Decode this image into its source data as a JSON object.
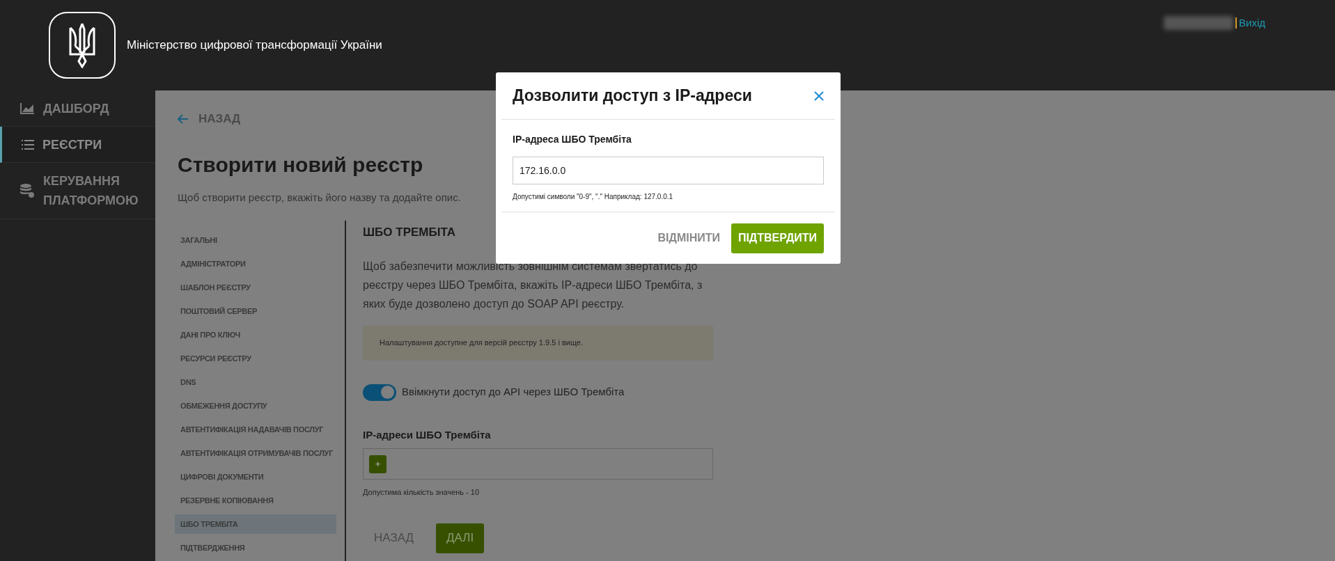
{
  "header": {
    "title": "Міністерство цифрової трансформації України",
    "exit_link": "Вихід"
  },
  "sidebar": {
    "items": [
      {
        "label": "ДАШБОРД",
        "selected": false
      },
      {
        "label": "РЕЄСТРИ",
        "selected": true
      },
      {
        "label": "КЕРУВАННЯ ПЛАТФОРМОЮ",
        "selected": false
      }
    ]
  },
  "page": {
    "back_link": "НАЗАД",
    "title": "Створити новий реєстр",
    "subtitle": "Щоб створити реєстр, вкажіть його назву та додайте опис.",
    "steps": [
      {
        "label": "ЗАГАЛЬНІ",
        "selected": false
      },
      {
        "label": "АДМІНІСТРАТОРИ",
        "selected": false
      },
      {
        "label": "ШАБЛОН РЕЄСТРУ",
        "selected": false
      },
      {
        "label": "ПОШТОВИЙ СЕРВЕР",
        "selected": false
      },
      {
        "label": "ДАНІ ПРО КЛЮЧ",
        "selected": false
      },
      {
        "label": "РЕСУРСИ РЕЄСТРУ",
        "selected": false
      },
      {
        "label": "DNS",
        "selected": false
      },
      {
        "label": "ОБМЕЖЕННЯ ДОСТУПУ",
        "selected": false
      },
      {
        "label": "АВТЕНТИФІКАЦІЯ НАДАВАЧІВ ПОСЛУГ",
        "selected": false
      },
      {
        "label": "АВТЕНТИФІКАЦІЯ ОТРИМУВАЧІВ ПОСЛУГ",
        "selected": false
      },
      {
        "label": "ЦИФРОВІ ДОКУМЕНТИ",
        "selected": false
      },
      {
        "label": "РЕЗЕРВНЕ КОПІЮВАННЯ",
        "selected": false
      },
      {
        "label": "ШБО ТРЕМБІТА",
        "selected": true
      },
      {
        "label": "ПІДТВЕРДЖЕННЯ",
        "selected": false
      }
    ],
    "section": {
      "title": "ШБО ТРЕМБІТА",
      "description": "Щоб забезпечити можливість зовнішнім системам звертатись до реєстру через ШБО Трембіта, вкажіть IP-адреси ШБО Трембіта, з яких буде дозволено доступ до SOAP API реєстру.",
      "notice": "Налаштування доступне для версій реєстру 1.9.5 і вище.",
      "toggle": {
        "label": "Ввімкнути доступ до API через ШБО Трембіта",
        "on": true
      },
      "ip_list": {
        "label": "IP-адреси ШБО Трембіта",
        "add_button": "+",
        "hint": "Допустима кількість значень - 10"
      },
      "back_button": "НАЗАД",
      "next_button": "ДАЛІ"
    }
  },
  "modal": {
    "title": "Дозволити доступ з IP-адреси",
    "field_label": "IP-адреса ШБО Трембіта",
    "value": "172.16.0.0",
    "hint": "Допустимі символи \"0-9\", \".\" Наприклад: 127.0.0.1",
    "cancel_button": "ВІДМІНИТИ",
    "confirm_button": "ПІДТВЕРДИТИ"
  }
}
